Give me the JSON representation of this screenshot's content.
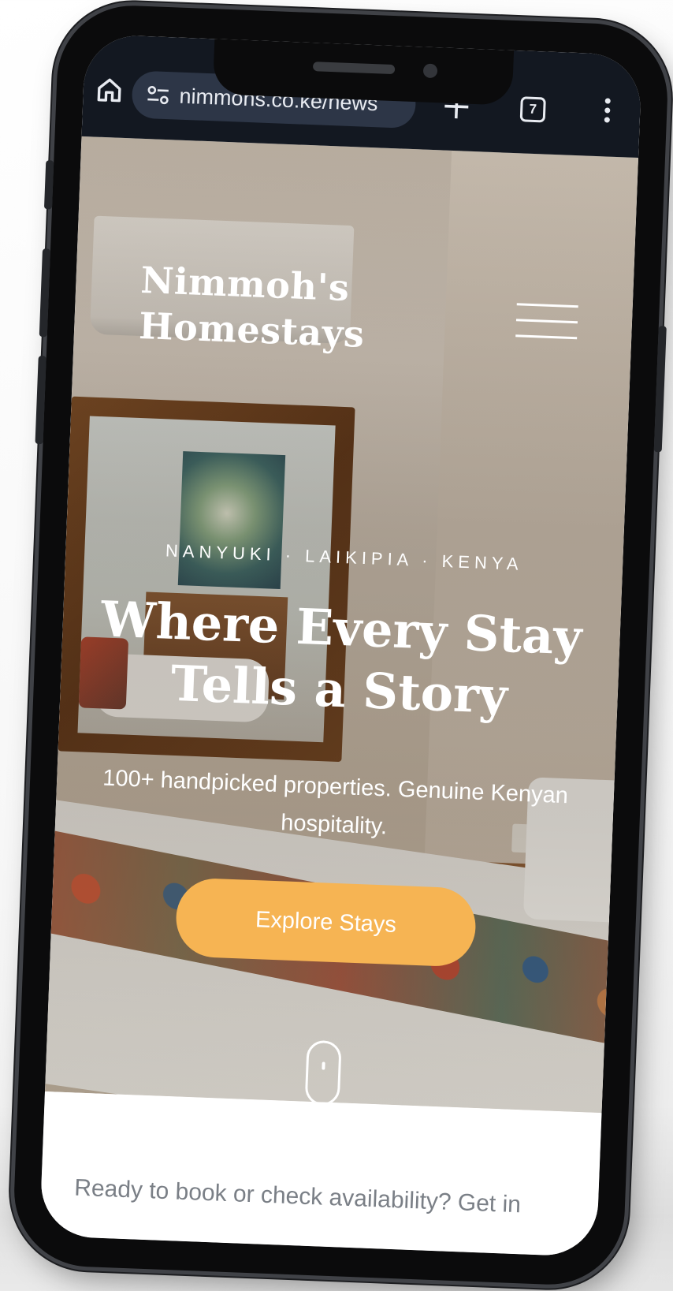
{
  "browser": {
    "url": "nimmohs.co.ke/news",
    "tab_count": "7"
  },
  "site": {
    "brand_line1": "Nimmoh's",
    "brand_line2": "Homestays"
  },
  "hero": {
    "eyebrow": "NANYUKI · LAIKIPIA · KENYA",
    "headline_line1": "Where Every Stay",
    "headline_line2": "Tells a Story",
    "subtitle_line1": "100+ handpicked properties. Genuine Kenyan",
    "subtitle_line2": "hospitality.",
    "cta_label": "Explore Stays"
  },
  "contact": {
    "prompt": "Ready to book or check availability? Get in"
  },
  "colors": {
    "cta": "#f6b453",
    "browser_bar": "#131821",
    "url_pill": "#2d3647"
  },
  "icons": [
    "home-icon",
    "site-settings-icon",
    "new-tab-plus-icon",
    "tab-switcher-icon",
    "overflow-menu-icon",
    "hamburger-menu-icon",
    "scroll-down-mouse-icon"
  ]
}
